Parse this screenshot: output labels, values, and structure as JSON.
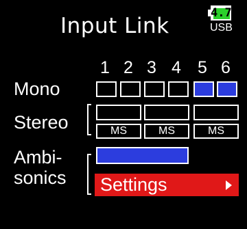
{
  "header": {
    "title": "Input Link",
    "battery_level": "4.7",
    "power_source": "USB"
  },
  "channels": [
    "1",
    "2",
    "3",
    "4",
    "5",
    "6"
  ],
  "rows": {
    "mono_label": "Mono",
    "stereo_label": "Stereo",
    "ambisonics_label_line1": "Ambi-",
    "ambisonics_label_line2": "sonics"
  },
  "mono_linked": [
    false,
    false,
    false,
    false,
    true,
    true
  ],
  "stereo_pairs": [
    {
      "channels": "1-2",
      "ms_label": "MS",
      "linked": false
    },
    {
      "channels": "3-4",
      "ms_label": "MS",
      "linked": false
    },
    {
      "channels": "5-6",
      "ms_label": "MS",
      "linked": false
    }
  ],
  "ambisonics": {
    "linked_channels": "1-4",
    "linked": true,
    "settings_label": "Settings"
  },
  "colors": {
    "accent_blue": "#2c3dde",
    "settings_red": "#e01818",
    "battery_green": "#2bd12b"
  }
}
